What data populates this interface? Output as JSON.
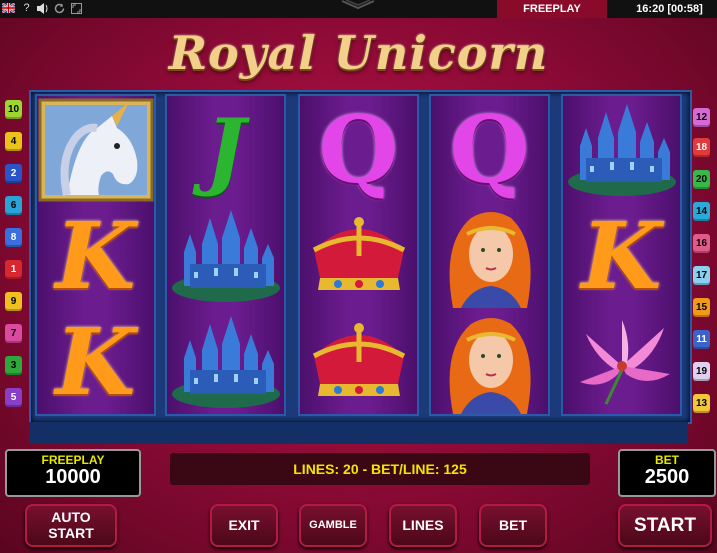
{
  "topbar": {
    "icons": [
      "flag-uk-icon",
      "help-icon",
      "sound-icon",
      "refresh-icon",
      "fullscreen-icon",
      "chevron-down-icon"
    ],
    "help_glyph": "?",
    "mode_tab": "FREEPLAY",
    "clock": "16:20 [00:58]"
  },
  "title": "Royal Unicorn",
  "reels": [
    [
      "unicorn",
      "K",
      "K"
    ],
    [
      "J",
      "castle",
      "castle"
    ],
    [
      "Q",
      "crown",
      "crown"
    ],
    [
      "Q",
      "lady",
      "lady"
    ],
    [
      "castle",
      "K",
      "lily"
    ]
  ],
  "left_lines": [
    "10",
    "4",
    "2",
    "6",
    "8",
    "1",
    "9",
    "7",
    "3",
    "5"
  ],
  "right_lines": [
    "12",
    "18",
    "20",
    "14",
    "16",
    "17",
    "15",
    "11",
    "19",
    "13"
  ],
  "colors": {
    "chip_palette": {
      "1": "#d8272f",
      "2": "#2a55c8",
      "3": "#2ea83a",
      "4": "#e9c21a",
      "5": "#8a3ec8",
      "6": "#2aa3d6",
      "7": "#d94aa0",
      "8": "#3a6fe0",
      "9": "#f0c020",
      "10": "#9ed630",
      "11": "#3c64c8",
      "12": "#d46ad4",
      "13": "#f2c83a",
      "14": "#2aaad8",
      "15": "#f09a1a",
      "16": "#e05a8a",
      "17": "#8ad0f0",
      "18": "#e03a3a",
      "19": "#e0d0f0",
      "20": "#38b848"
    }
  },
  "credit": {
    "label": "FREEPLAY",
    "value": "10000"
  },
  "bet": {
    "label": "BET",
    "value": "2500"
  },
  "lines_info": "LINES: 20  -  BET/LINE: 125",
  "buttons": {
    "autostart_line1": "AUTO",
    "autostart_line2": "START",
    "exit": "EXIT",
    "gamble": "GAMBLE",
    "lines": "LINES",
    "bet": "BET",
    "start": "START"
  }
}
